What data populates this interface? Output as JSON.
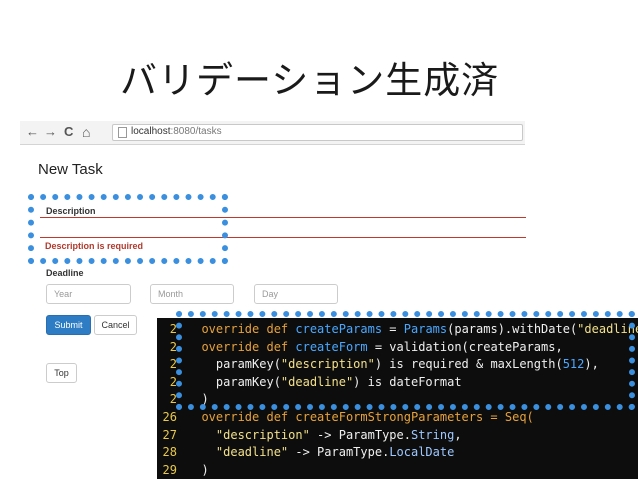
{
  "slide": {
    "title": "バリデーション生成済"
  },
  "browser": {
    "back_icon": "←",
    "forward_icon": "→",
    "reload_icon": "C",
    "home_icon": "⌂",
    "url_host": "localhost",
    "url_rest": ":8080/tasks"
  },
  "form": {
    "heading": "New Task",
    "description_label": "Description",
    "description_error": "Description is required",
    "deadline_label": "Deadline",
    "year_placeholder": "Year",
    "month_placeholder": "Month",
    "day_placeholder": "Day",
    "submit_label": "Submit",
    "cancel_label": "Cancel",
    "top_label": "Top"
  },
  "code": {
    "lines": [
      {
        "no": "2",
        "segments": [
          {
            "t": "  override def ",
            "c": "kw"
          },
          {
            "t": "createParams",
            "c": "fn"
          },
          {
            "t": " = ",
            "c": "pl"
          },
          {
            "t": "Params",
            "c": "fn"
          },
          {
            "t": "(params).withDate(",
            "c": "pl"
          },
          {
            "t": "\"deadline\"",
            "c": "str"
          },
          {
            "t": ")",
            "c": "pl"
          }
        ]
      },
      {
        "no": "2",
        "segments": [
          {
            "t": "  override def ",
            "c": "kw"
          },
          {
            "t": "createForm",
            "c": "fn"
          },
          {
            "t": " = validation(createParams,",
            "c": "pl"
          }
        ]
      },
      {
        "no": "2",
        "segments": [
          {
            "t": "    paramKey(",
            "c": "pl"
          },
          {
            "t": "\"description\"",
            "c": "str"
          },
          {
            "t": ") is required & maxLength(",
            "c": "pl"
          },
          {
            "t": "512",
            "c": "fn"
          },
          {
            "t": "),",
            "c": "pl"
          }
        ]
      },
      {
        "no": "2",
        "segments": [
          {
            "t": "    paramKey(",
            "c": "pl"
          },
          {
            "t": "\"deadline\"",
            "c": "str"
          },
          {
            "t": ") is dateFormat",
            "c": "pl"
          }
        ]
      },
      {
        "no": "2",
        "segments": [
          {
            "t": "  )",
            "c": "pl"
          }
        ]
      },
      {
        "no": "26",
        "segments": [
          {
            "t": "  override def createFormStrongParameters = Seq(",
            "c": "kw"
          }
        ]
      },
      {
        "no": "27",
        "segments": [
          {
            "t": "    ",
            "c": "pl"
          },
          {
            "t": "\"description\"",
            "c": "str"
          },
          {
            "t": " -> ParamType.",
            "c": "pl"
          },
          {
            "t": "String",
            "c": "ty"
          },
          {
            "t": ",",
            "c": "pl"
          }
        ]
      },
      {
        "no": "28",
        "segments": [
          {
            "t": "    ",
            "c": "pl"
          },
          {
            "t": "\"deadline\"",
            "c": "str"
          },
          {
            "t": " -> ParamType.",
            "c": "pl"
          },
          {
            "t": "LocalDate",
            "c": "ty"
          }
        ]
      },
      {
        "no": "29",
        "segments": [
          {
            "t": "  )",
            "c": "pl"
          }
        ]
      }
    ]
  }
}
